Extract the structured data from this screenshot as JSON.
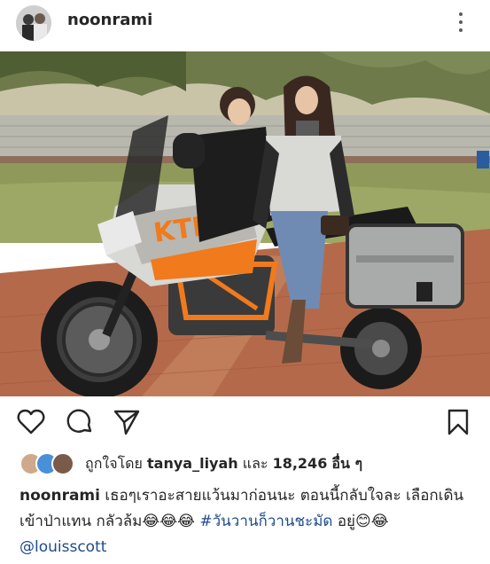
{
  "post": {
    "username": "noonrami",
    "likes_prefix": "ถูกใจโดย",
    "liked_by_user": "tanya_liyah",
    "likes_conjunction": "และ",
    "likes_count": "18,246",
    "likes_suffix": "อื่น ๆ",
    "caption_user": "noonrami",
    "caption_text": " เธอๆเราอะสายแว้นมาก่อนนะ ตอนนี้กลับใจละ เลือกเดินเข้าป่าแทน กลัวล้ม😂😂😂 ",
    "hashtag": "#วันวานก็วานชะมัด",
    "caption_after_tag": " อยู่😊😂 ",
    "mention": "@louisscott"
  },
  "icons": {
    "more": "more-vertical-icon",
    "like": "heart-icon",
    "comment": "comment-icon",
    "share": "send-icon",
    "save": "bookmark-icon"
  }
}
